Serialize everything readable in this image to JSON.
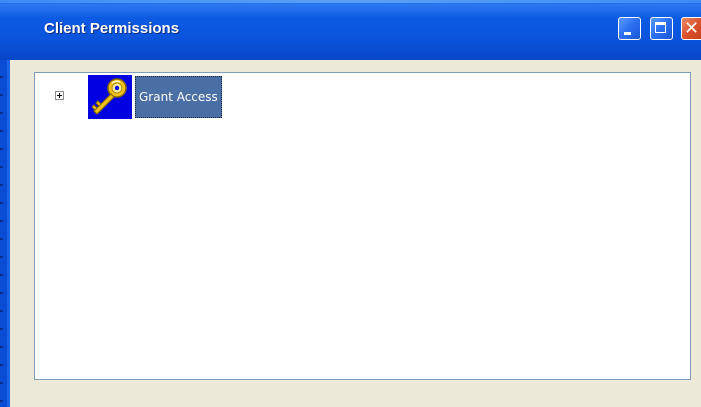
{
  "window": {
    "title": "Client Permissions",
    "controls": {
      "minimize": "minimize-icon",
      "maximize": "maximize-icon",
      "close": "close-icon"
    }
  },
  "tree": {
    "nodes": [
      {
        "label": "Grant Access",
        "icon": "key-icon",
        "expanded": false,
        "selected": true
      }
    ]
  },
  "colors": {
    "titlebar": "#0b55dd",
    "client_bg": "#ece9d8",
    "selection": "#4a6fa5",
    "icon_bg": "#0000e0",
    "key": "#f0c000"
  }
}
